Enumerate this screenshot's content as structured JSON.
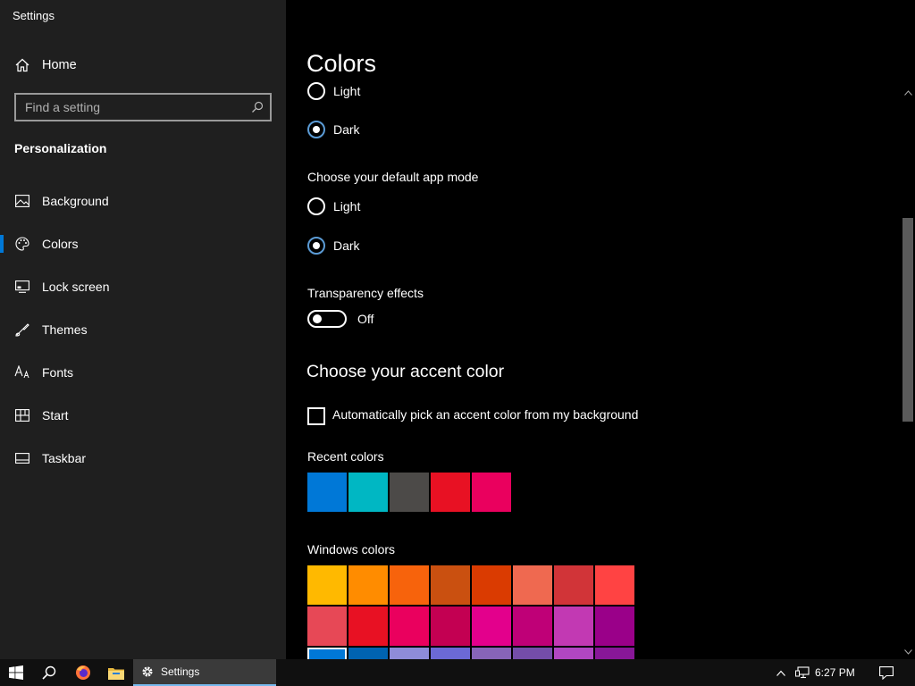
{
  "window": {
    "title": "Settings"
  },
  "sidebar": {
    "home_label": "Home",
    "search_placeholder": "Find a setting",
    "section_heading": "Personalization",
    "items": [
      {
        "label": "Background",
        "icon": "picture-icon"
      },
      {
        "label": "Colors",
        "icon": "palette-icon",
        "selected": true
      },
      {
        "label": "Lock screen",
        "icon": "lock-screen-icon"
      },
      {
        "label": "Themes",
        "icon": "brush-icon"
      },
      {
        "label": "Fonts",
        "icon": "fonts-icon"
      },
      {
        "label": "Start",
        "icon": "start-icon"
      },
      {
        "label": "Taskbar",
        "icon": "taskbar-icon"
      }
    ]
  },
  "main": {
    "title": "Colors",
    "windows_mode": {
      "options": [
        {
          "label": "Light",
          "checked": false
        },
        {
          "label": "Dark",
          "checked": true
        }
      ]
    },
    "app_mode": {
      "heading": "Choose your default app mode",
      "options": [
        {
          "label": "Light",
          "checked": false
        },
        {
          "label": "Dark",
          "checked": true
        }
      ]
    },
    "transparency": {
      "heading": "Transparency effects",
      "state": "Off",
      "on": false
    },
    "accent": {
      "heading": "Choose your accent color",
      "auto_label": "Automatically pick an accent color from my background",
      "auto_checked": false,
      "recent_heading": "Recent colors",
      "recent_colors": [
        "#0078d7",
        "#00b7c3",
        "#4c4a48",
        "#e81123",
        "#ea005e"
      ],
      "windows_heading": "Windows colors",
      "windows_colors": [
        [
          "#ffb900",
          "#ff8c00",
          "#f7630c",
          "#ca5010",
          "#da3b01",
          "#ef6950",
          "#d13438",
          "#ff4343"
        ],
        [
          "#e74856",
          "#e81123",
          "#ea005e",
          "#c30052",
          "#e3008c",
          "#bf0077",
          "#c239b3",
          "#9a0089"
        ],
        [
          "#0078d7",
          "#0063b1",
          "#8e8cd8",
          "#6b69d6",
          "#8764b8",
          "#744da9",
          "#b146c2",
          "#881798"
        ]
      ],
      "selected_color": "#0078d7"
    }
  },
  "taskbar": {
    "app_label": "Settings",
    "time": "6:27 PM"
  },
  "colors": {
    "accent": "#0078d7",
    "sidebar_bg": "#1f1f1f",
    "content_bg": "#000000"
  }
}
